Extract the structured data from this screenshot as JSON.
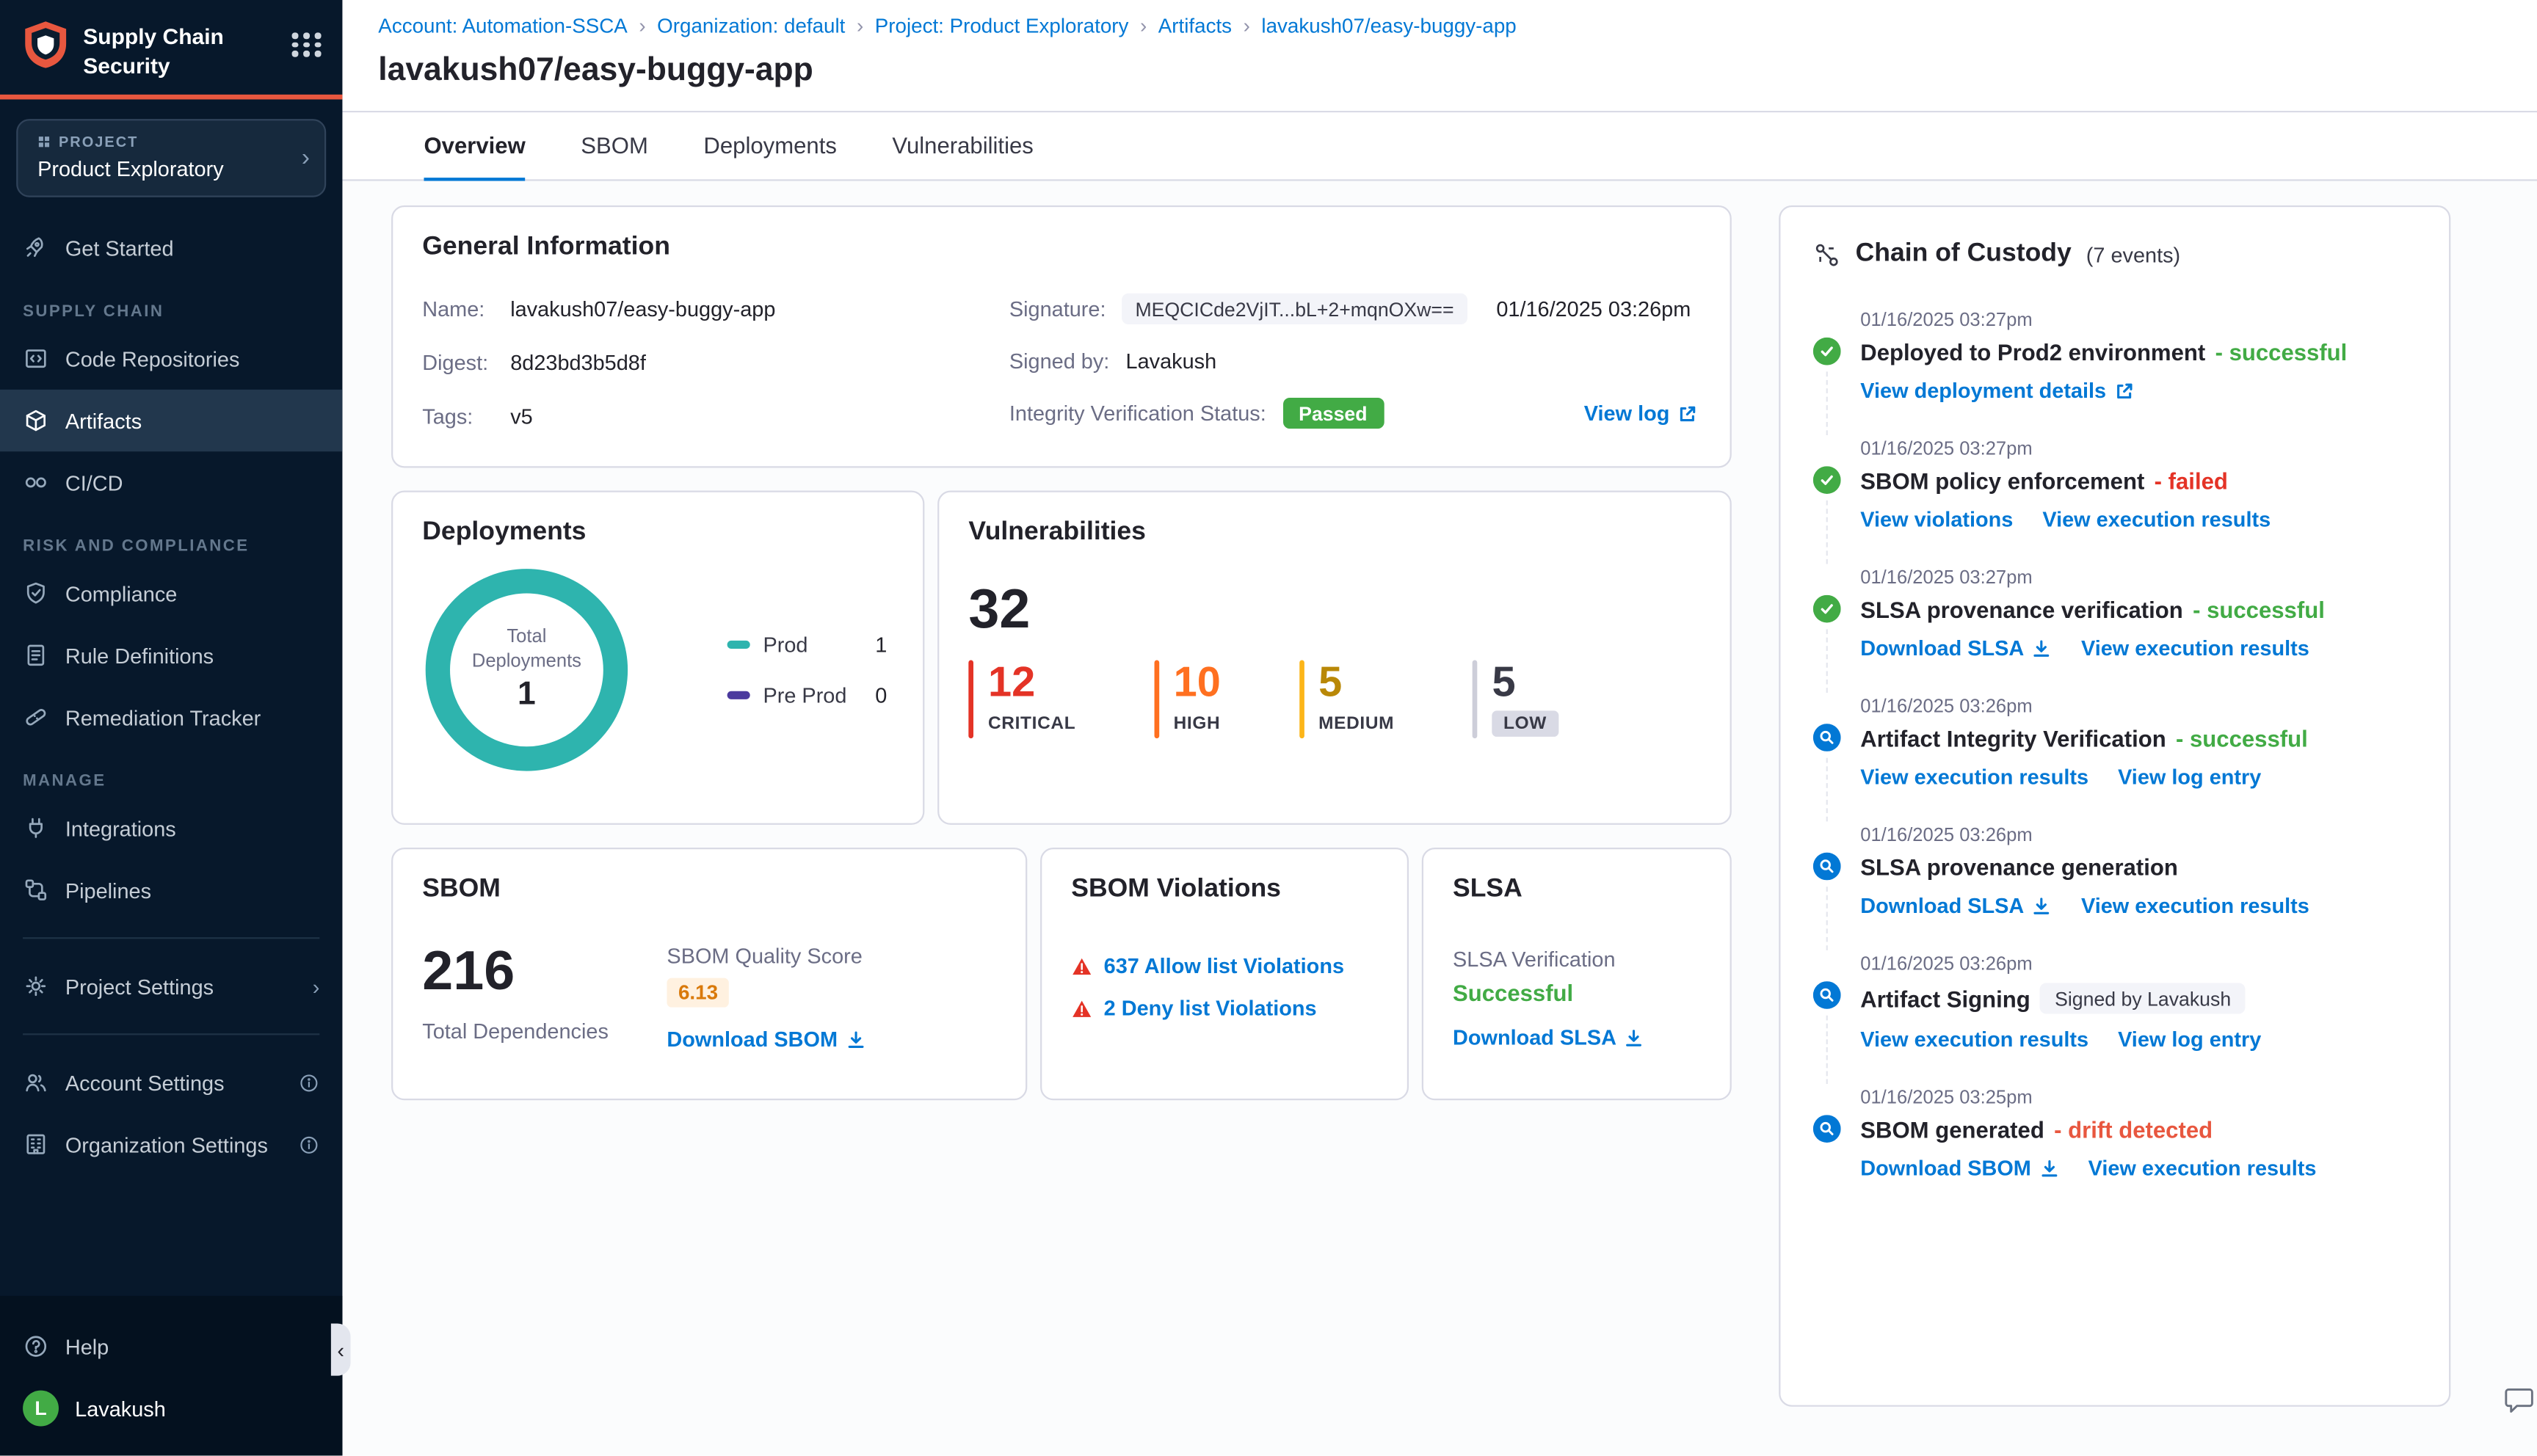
{
  "colors": {
    "accent_orange": "#e8573f",
    "link_blue": "#0278d5",
    "success_green": "#42ab45",
    "critical_red": "#e43326",
    "high_orange": "#ff7020",
    "medium_amber": "#fcb519",
    "low_gray": "#d9dae5",
    "deployments_teal": "#2eb4ae",
    "preprod_purple": "#4b3a9e",
    "sidebar_navy": "#07182b"
  },
  "misc": {
    "chev_right": "›",
    "chev_left": "‹"
  },
  "sidebar": {
    "app_title": "Supply Chain Security",
    "project_label": "PROJECT",
    "project_name": "Product Exploratory",
    "get_started": "Get Started",
    "groups": [
      {
        "label": "SUPPLY CHAIN",
        "items": [
          {
            "label": "Code Repositories"
          },
          {
            "label": "Artifacts"
          },
          {
            "label": "CI/CD"
          }
        ]
      },
      {
        "label": "RISK AND COMPLIANCE",
        "items": [
          {
            "label": "Compliance"
          },
          {
            "label": "Rule Definitions"
          },
          {
            "label": "Remediation Tracker"
          }
        ]
      },
      {
        "label": "MANAGE",
        "items": [
          {
            "label": "Integrations"
          },
          {
            "label": "Pipelines"
          }
        ]
      }
    ],
    "project_settings": "Project Settings",
    "account_settings": "Account Settings",
    "organization_settings": "Organization Settings",
    "help": "Help",
    "user": {
      "name": "Lavakush",
      "initial": "L"
    }
  },
  "breadcrumb": {
    "separator": "›",
    "items": [
      "Account: Automation-SSCA",
      "Organization: default",
      "Project: Product Exploratory",
      "Artifacts",
      "lavakush07/easy-buggy-app"
    ]
  },
  "header": {
    "title": "lavakush07/easy-buggy-app"
  },
  "tabs": {
    "active": "Overview",
    "items": [
      "Overview",
      "SBOM",
      "Deployments",
      "Vulnerabilities"
    ]
  },
  "gi": {
    "title": "General Information",
    "name_label": "Name:",
    "name": "lavakush07/easy-buggy-app",
    "digest_label": "Digest:",
    "digest": "8d23bd3b5d8f",
    "tags_label": "Tags:",
    "tags": "v5",
    "signature_label": "Signature:",
    "signature": "MEQCICde2VjIT...bL+2+mqnOXw==",
    "signature_date": "01/16/2025 03:26pm",
    "signed_by_label": "Signed by:",
    "signed_by": "Lavakush",
    "integrity_label": "Integrity Verification Status:",
    "integrity_status": "Passed",
    "view_log": "View log"
  },
  "dep": {
    "title": "Deployments",
    "center_top": "Total",
    "center_mid": "Deployments",
    "total": "1",
    "legend": [
      {
        "label": "Prod",
        "value": "1"
      },
      {
        "label": "Pre Prod",
        "value": "0"
      }
    ]
  },
  "vuln": {
    "title": "Vulnerabilities",
    "total": "32",
    "severities": [
      {
        "count": "12",
        "label": "CRITICAL"
      },
      {
        "count": "10",
        "label": "HIGH"
      },
      {
        "count": "5",
        "label": "MEDIUM"
      },
      {
        "count": "5",
        "label": "LOW"
      }
    ]
  },
  "sbom": {
    "title": "SBOM",
    "total": "216",
    "total_label": "Total Dependencies",
    "score_label": "SBOM Quality Score",
    "score": "6.13",
    "download": "Download SBOM"
  },
  "viol": {
    "title": "SBOM Violations",
    "items": [
      "637 Allow list Violations",
      "2 Deny list Violations"
    ]
  },
  "slsa": {
    "title": "SLSA",
    "verification_label": "SLSA Verification",
    "status": "Successful",
    "download": "Download SLSA"
  },
  "coc": {
    "title": "Chain of Custody",
    "count": "(7 events)",
    "events": [
      {
        "ts": "01/16/2025 03:27pm",
        "title": "Deployed to Prod2 environment",
        "status": "- successful",
        "links": [
          {
            "label": "View deployment details"
          }
        ]
      },
      {
        "ts": "01/16/2025 03:27pm",
        "title": "SBOM policy enforcement",
        "status": "- failed",
        "links": [
          {
            "label": "View violations"
          },
          {
            "label": "View execution results"
          }
        ]
      },
      {
        "ts": "01/16/2025 03:27pm",
        "title": "SLSA provenance verification",
        "status": "- successful",
        "links": [
          {
            "label": "Download SLSA"
          },
          {
            "label": "View execution results"
          }
        ]
      },
      {
        "ts": "01/16/2025 03:26pm",
        "title": "Artifact Integrity Verification",
        "status": "- successful",
        "links": [
          {
            "label": "View execution results"
          },
          {
            "label": "View log entry"
          }
        ]
      },
      {
        "ts": "01/16/2025 03:26pm",
        "title": "SLSA provenance generation",
        "status": "",
        "links": [
          {
            "label": "Download SLSA"
          },
          {
            "label": "View execution results"
          }
        ]
      },
      {
        "ts": "01/16/2025 03:26pm",
        "title": "Artifact Signing",
        "status": "",
        "badge": "Signed by Lavakush",
        "links": [
          {
            "label": "View execution results"
          },
          {
            "label": "View log entry"
          }
        ]
      },
      {
        "ts": "01/16/2025 03:25pm",
        "title": "SBOM generated",
        "status": "- drift detected",
        "links": [
          {
            "label": "Download SBOM"
          },
          {
            "label": "View execution results"
          }
        ]
      }
    ]
  }
}
